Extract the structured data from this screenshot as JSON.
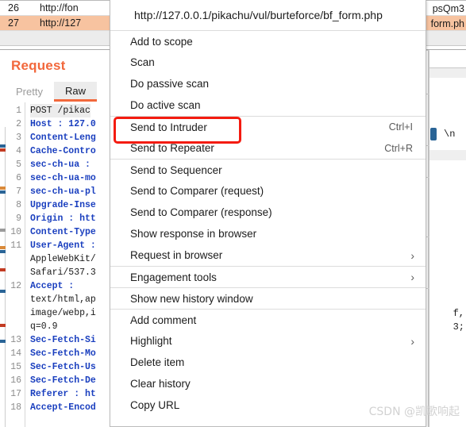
{
  "history": {
    "rows": [
      {
        "index": "26",
        "host": "http://fon",
        "tail": "psQm3"
      },
      {
        "index": "27",
        "host": "http://127",
        "tail": "form.ph"
      }
    ]
  },
  "request_panel": {
    "title": "Request",
    "tabs": [
      {
        "label": "Pretty",
        "active": false
      },
      {
        "label": "Raw",
        "active": true
      }
    ],
    "lines": [
      {
        "num": "1",
        "text": "POST  /pikac",
        "style": "first"
      },
      {
        "num": "2",
        "text": "Host : 127.0",
        "style": "hdr"
      },
      {
        "num": "3",
        "text": "Content-Leng",
        "style": "hdr"
      },
      {
        "num": "4",
        "text": "Cache-Contro",
        "style": "hdr"
      },
      {
        "num": "5",
        "text": "sec-ch-ua :",
        "style": "hdr"
      },
      {
        "num": "6",
        "text": "sec-ch-ua-mo",
        "style": "hdr"
      },
      {
        "num": "7",
        "text": "sec-ch-ua-pl",
        "style": "hdr"
      },
      {
        "num": "8",
        "text": "Upgrade-Inse",
        "style": "hdr"
      },
      {
        "num": "9",
        "text": "Origin : htt",
        "style": "hdr"
      },
      {
        "num": "10",
        "text": "Content-Type",
        "style": "hdr"
      },
      {
        "num": "11",
        "text": "User-Agent :",
        "style": "hdr"
      },
      {
        "num": "",
        "text": "AppleWebKit/",
        "style": "plain"
      },
      {
        "num": "",
        "text": "Safari/537.3",
        "style": "plain"
      },
      {
        "num": "12",
        "text": "Accept :",
        "style": "hdr"
      },
      {
        "num": "",
        "text": "text/html,ap",
        "style": "plain"
      },
      {
        "num": "",
        "text": "image/webp,i",
        "style": "plain"
      },
      {
        "num": "",
        "text": "q=0.9",
        "style": "plain"
      },
      {
        "num": "13",
        "text": "Sec-Fetch-Si",
        "style": "hdr"
      },
      {
        "num": "14",
        "text": "Sec-Fetch-Mo",
        "style": "hdr"
      },
      {
        "num": "15",
        "text": "Sec-Fetch-Us",
        "style": "hdr"
      },
      {
        "num": "16",
        "text": "Sec-Fetch-De",
        "style": "hdr"
      },
      {
        "num": "17",
        "text": "Referer : ht",
        "style": "hdr"
      },
      {
        "num": "18",
        "text": "Accept-Encod",
        "style": "hdr"
      }
    ]
  },
  "response_fragments": {
    "newline_token": "\\n",
    "frag_a": "f,",
    "frag_b": "3;"
  },
  "context_menu": {
    "url_header": "http://127.0.0.1/pikachu/vul/burteforce/bf_form.php",
    "items": [
      {
        "label": "Add to scope",
        "accel": "",
        "submenu": false,
        "separator_above": true
      },
      {
        "label": "Scan",
        "accel": "",
        "submenu": false,
        "separator_above": false
      },
      {
        "label": "Do passive scan",
        "accel": "",
        "submenu": false,
        "separator_above": false
      },
      {
        "label": "Do active scan",
        "accel": "",
        "submenu": false,
        "separator_above": false
      },
      {
        "label": "Send to Intruder",
        "accel": "Ctrl+I",
        "submenu": false,
        "separator_above": true
      },
      {
        "label": "Send to Repeater",
        "accel": "Ctrl+R",
        "submenu": false,
        "separator_above": false
      },
      {
        "label": "Send to Sequencer",
        "accel": "",
        "submenu": false,
        "separator_above": true
      },
      {
        "label": "Send to Comparer (request)",
        "accel": "",
        "submenu": false,
        "separator_above": false
      },
      {
        "label": "Send to Comparer (response)",
        "accel": "",
        "submenu": false,
        "separator_above": false
      },
      {
        "label": "Show response in browser",
        "accel": "",
        "submenu": false,
        "separator_above": false
      },
      {
        "label": "Request in browser",
        "accel": "",
        "submenu": true,
        "separator_above": false
      },
      {
        "label": "Engagement tools",
        "accel": "",
        "submenu": true,
        "separator_above": true
      },
      {
        "label": "Show new history window",
        "accel": "",
        "submenu": false,
        "separator_above": true
      },
      {
        "label": "Add comment",
        "accel": "",
        "submenu": false,
        "separator_above": true
      },
      {
        "label": "Highlight",
        "accel": "",
        "submenu": true,
        "separator_above": false
      },
      {
        "label": "Delete item",
        "accel": "",
        "submenu": false,
        "separator_above": false
      },
      {
        "label": "Clear history",
        "accel": "",
        "submenu": false,
        "separator_above": false
      },
      {
        "label": "Copy URL",
        "accel": "",
        "submenu": false,
        "separator_above": false
      }
    ]
  },
  "annotation": {
    "highlight_target": "Send to Intruder",
    "highlight_color": "#f41b10"
  },
  "watermark": "CSDN @凯歌响起",
  "colors": {
    "accent_orange": "#f2683c",
    "row_selected": "#f7c3a0",
    "annotation_red": "#f41b10"
  }
}
